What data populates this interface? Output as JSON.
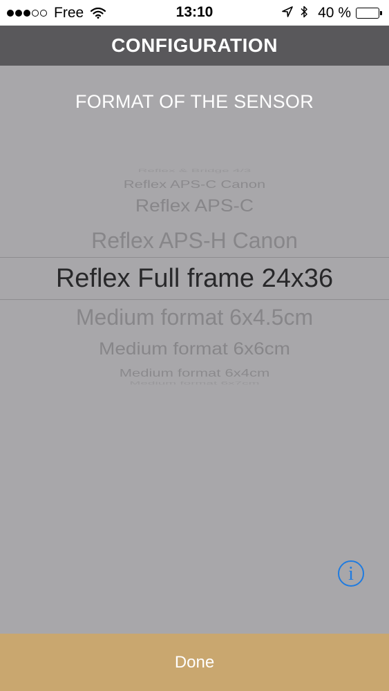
{
  "status_bar": {
    "carrier": "Free",
    "time": "13:10",
    "battery_percent": "40 %",
    "battery_level": 0.4,
    "signal_bars_filled": 3,
    "signal_bars_total": 5,
    "icons": [
      "wifi-icon",
      "location-arrow-icon",
      "bluetooth-icon",
      "battery-icon"
    ]
  },
  "nav": {
    "title": "CONFIGURATION"
  },
  "section": {
    "title": "FORMAT OF THE SENSOR"
  },
  "picker": {
    "options": [
      "Reflex & Bridge 4/3",
      "Reflex APS-C Canon",
      "Reflex APS-C",
      "Reflex APS-H Canon",
      "Reflex Full frame 24x36",
      "Medium format 6x4.5cm",
      "Medium format 6x6cm",
      "Medium format 6x4cm",
      "Medium format 6x7cm"
    ],
    "selected": "Reflex Full frame 24x36"
  },
  "info_button": {
    "glyph": "i"
  },
  "footer": {
    "done_label": "Done"
  },
  "colors": {
    "background": "#a8a7aa",
    "nav_bar": "#59585b",
    "done_bar": "#c9a76f",
    "info_accent": "#1f7be0"
  }
}
